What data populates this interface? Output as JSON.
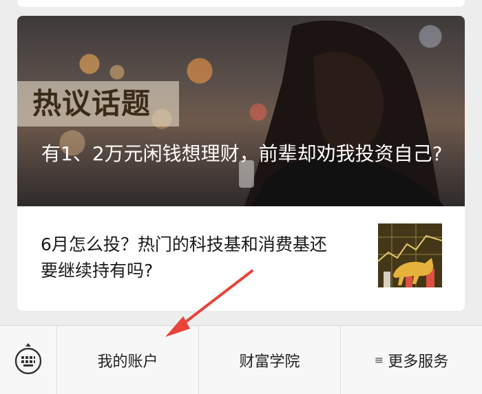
{
  "hero": {
    "tag": "热议话题",
    "title": "有1、2万元闲钱想理财，前辈却劝我投资自己?"
  },
  "article": {
    "title": "6月怎么投？热门的科技基和消费基还要继续持有吗?"
  },
  "bottom_menu": {
    "items": [
      {
        "label": "我的账户"
      },
      {
        "label": "财富学院"
      },
      {
        "label": "更多服务",
        "icon": "≡"
      }
    ]
  },
  "colors": {
    "background": "#ededed",
    "card": "#ffffff",
    "annotation_arrow": "#e8443a"
  }
}
